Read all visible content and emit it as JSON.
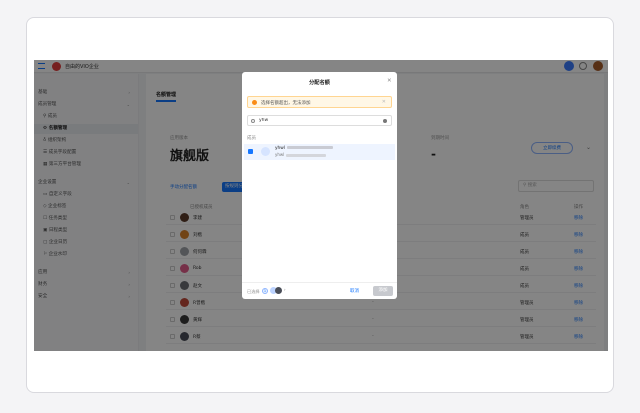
{
  "topbar": {
    "org_title": "自由的VIO企业"
  },
  "sidebar": {
    "items": [
      {
        "label": "基础",
        "chev": "›",
        "type": "group"
      },
      {
        "label": "成员管理",
        "chev": "⌄",
        "type": "group"
      },
      {
        "label": "成员",
        "type": "sub"
      },
      {
        "label": "名额管理",
        "type": "sub",
        "active": true
      },
      {
        "label": "组织架构",
        "type": "sub"
      },
      {
        "label": "成员字段配置",
        "type": "sub"
      },
      {
        "label": "第三方平台管理",
        "type": "sub"
      },
      {
        "label": "企业设置",
        "chev": "⌄",
        "type": "group"
      },
      {
        "label": "自定义字段",
        "type": "sub"
      },
      {
        "label": "企业标签",
        "type": "sub"
      },
      {
        "label": "任务类型",
        "type": "sub"
      },
      {
        "label": "日程类型",
        "type": "sub"
      },
      {
        "label": "企业日历",
        "type": "sub"
      },
      {
        "label": "企业水印",
        "type": "sub"
      },
      {
        "label": "应用",
        "chev": "›",
        "type": "group"
      },
      {
        "label": "财务",
        "chev": "›",
        "type": "group"
      },
      {
        "label": "安全",
        "chev": "›",
        "type": "group"
      }
    ]
  },
  "main": {
    "tab": "名额管理",
    "plan_label": "应用版本",
    "plan_name": "旗舰版",
    "expire_label": "到期时间",
    "expire_value": "-",
    "renew_label": "立即续费",
    "auto_assign_label": "手动分配名额",
    "batch_label": "按规则分配",
    "search_placeholder": "搜索",
    "table": {
      "headers": {
        "member": "已授权成员",
        "role": "角色",
        "op": "操作"
      },
      "rows": [
        {
          "name": "李建",
          "dash": "-",
          "role": "管理员",
          "op": "移除",
          "color": "#5a3a2a"
        },
        {
          "name": "刘楷",
          "dash": "-",
          "role": "成员",
          "op": "移除",
          "color": "#d9822b"
        },
        {
          "name": "何何霖",
          "dash": "-",
          "role": "成员",
          "op": "移除",
          "color": "#a0a4aa"
        },
        {
          "name": "Rob",
          "dash": "-",
          "role": "成员",
          "op": "移除",
          "color": "#e35d8a"
        },
        {
          "name": "赵文",
          "dash": "-",
          "role": "成员",
          "op": "移除",
          "color": "#6b6e74"
        },
        {
          "name": "R曾楷",
          "dash": "-",
          "role": "管理员",
          "op": "移除",
          "color": "#c04a3a"
        },
        {
          "name": "黄辉",
          "dash": "-",
          "role": "管理员",
          "op": "移除",
          "color": "#3a3a3a"
        },
        {
          "name": "R蔡",
          "dash": "-",
          "role": "管理员",
          "op": "移除",
          "color": "#4a4e58"
        }
      ]
    }
  },
  "modal": {
    "title": "分配名额",
    "warning": "选择名额超出，无法添加",
    "search_value": "yhw",
    "section_label": "成员",
    "member": {
      "name": "yhwl",
      "sub": "yhwl"
    },
    "selected_label": "已选择",
    "selected_count": "1",
    "cancel_label": "取消",
    "ok_label": "添加"
  }
}
